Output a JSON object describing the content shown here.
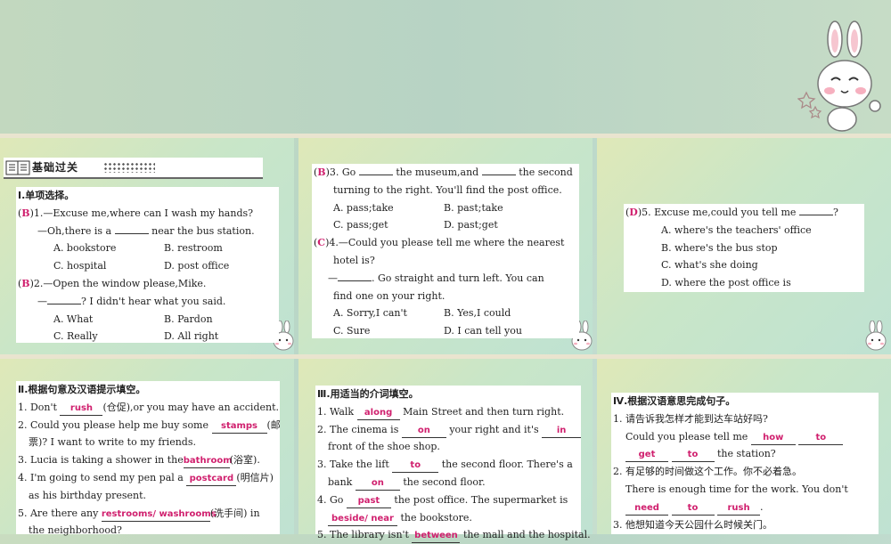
{
  "banner": {
    "title": "基础过关"
  },
  "s1": {
    "section": "Ⅰ.单项选择。",
    "q1": {
      "ans": "B",
      "line1": ")1.—Excuse me,where can I wash my hands?",
      "line2a": "—Oh,there is a",
      "line2b": "near the bus station.",
      "A": "A. bookstore",
      "B": "B. restroom",
      "C": "C. hospital",
      "D": "D. post office"
    },
    "q2": {
      "ans": "B",
      "line1": ")2.—Open the window please,Mike.",
      "line2a": "—",
      "line2b": "? I didn't hear what you said.",
      "A": "A. What",
      "B": "B. Pardon",
      "C": "C. Really",
      "D": "D. All right"
    }
  },
  "s2": {
    "q3": {
      "ans": "B",
      "l1a": ")3. Go",
      "l1b": "the museum,and",
      "l1c": "the second",
      "l2": "turning to the right. You'll find the post office.",
      "A": "A. pass;take",
      "B": "B. past;take",
      "C": "C. pass;get",
      "D": "D. past;get"
    },
    "q4": {
      "ans": "C",
      "l1": ")4.—Could you please tell me where the nearest",
      "l2": "hotel is?",
      "l3a": "—",
      "l3b": ". Go straight and turn left. You can",
      "l4": "find one on your right.",
      "A": "A. Sorry,I can't",
      "B": "B. Yes,I could",
      "C": "C. Sure",
      "D": "D. I can tell you"
    }
  },
  "s3": {
    "q5": {
      "ans": "D",
      "l1a": ")5. Excuse me,could you tell me",
      "l1b": "?",
      "A": "A. where's the teachers' office",
      "B": "B. where's the bus stop",
      "C": "C. what's she doing",
      "D": "D. where the post office is"
    }
  },
  "s4": {
    "section": "Ⅱ.根据句意及汉语提示填空。",
    "l1a": "1. Don't",
    "l1f": "rush",
    "l1b": "(仓促),or you may have an accident.",
    "l2a": "2. Could you please help me buy some",
    "l2f": "stamps",
    "l2b": "(邮",
    "l3": "票)? I want to write to my friends.",
    "l4a": "3. Lucia is taking a shower in the",
    "l4f": "bathroom",
    "l4b": "(浴室).",
    "l5a": "4. I'm going to send my pen pal a",
    "l5f": "postcard",
    "l5b": "(明信片)",
    "l6": "as his birthday present.",
    "l7a": "5. Are there any",
    "l7f": "restrooms/ washrooms",
    "l7b": "(洗手间) in",
    "l8": "the neighborhood?"
  },
  "s5": {
    "section": "Ⅲ.用适当的介词填空。",
    "l1a": "1. Walk",
    "l1f": "along",
    "l1b": "Main Street and then turn right.",
    "l2a": "2. The cinema is",
    "l2f": "on",
    "l2b": "your right and it's",
    "l2f2": "in",
    "l3": "front of the shoe shop.",
    "l4a": "3. Take the lift",
    "l4f": "to",
    "l4b": "the second floor. There's a",
    "l5a": "bank",
    "l5f": "on",
    "l5b": "the second floor.",
    "l6a": "4. Go",
    "l6f": "past",
    "l6b": "the post office. The supermarket is",
    "l7f": "beside/ near",
    "l7b": "the bookstore.",
    "l8a": "5. The library isn't",
    "l8f": "between",
    "l8b": "the mall and the hospital."
  },
  "s6": {
    "section": "Ⅳ.根据汉语意思完成句子。",
    "l1": "1. 请告诉我怎样才能到达车站好吗?",
    "l2a": "Could you please tell me",
    "l2f": "how",
    "l2f2": "to",
    "l3f": "get",
    "l3f2": "to",
    "l3b": "the station?",
    "l4": "2. 有足够的时间做这个工作。你不必着急。",
    "l5": "There is enough time for the work. You don't",
    "l6f": "need",
    "l6f2": "to",
    "l6f3": "rush",
    "l6b": ".",
    "l7": "3. 他想知道今天公园什么时候关门。"
  }
}
